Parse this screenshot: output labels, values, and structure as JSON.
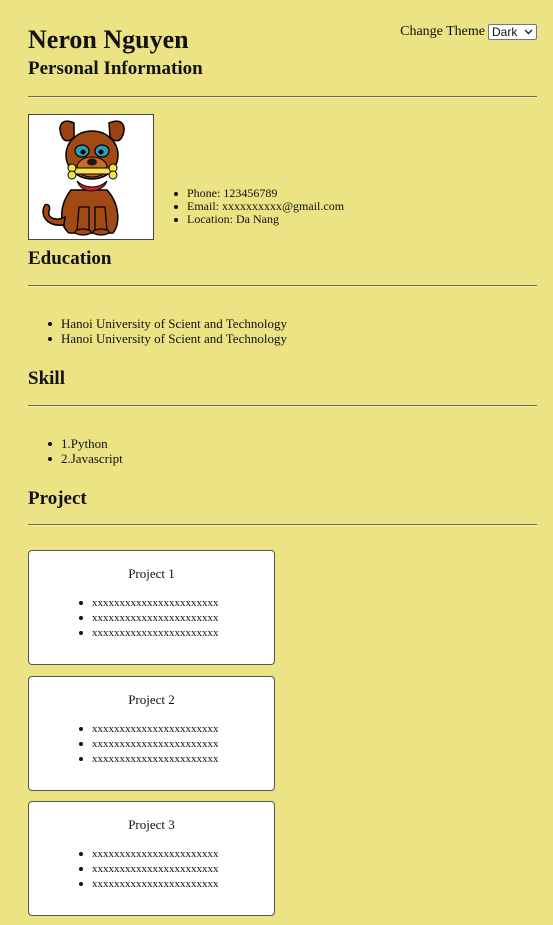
{
  "header": {
    "name": "Neron Nguyen",
    "theme_label": "Change Theme",
    "theme_selected": "Dark"
  },
  "personal": {
    "title": "Personal Information",
    "avatar_icon": "cartoon-dog-avatar",
    "items": [
      "Phone: 123456789",
      "Email: xxxxxxxxxx@gmail.com",
      "Location: Da Nang"
    ]
  },
  "education": {
    "title": "Education",
    "items": [
      "Hanoi University of Scient and Technology",
      "Hanoi University of Scient and Technology"
    ]
  },
  "skill": {
    "title": "Skill",
    "items": [
      "1.Python",
      "2.Javascript"
    ]
  },
  "project": {
    "title": "Project",
    "cards": [
      {
        "title": "Project 1",
        "items": [
          "xxxxxxxxxxxxxxxxxxxxxxx",
          "xxxxxxxxxxxxxxxxxxxxxxx",
          "xxxxxxxxxxxxxxxxxxxxxxx"
        ]
      },
      {
        "title": "Project 2",
        "items": [
          "xxxxxxxxxxxxxxxxxxxxxxx",
          "xxxxxxxxxxxxxxxxxxxxxxx",
          "xxxxxxxxxxxxxxxxxxxxxxx"
        ]
      },
      {
        "title": "Project 3",
        "items": [
          "xxxxxxxxxxxxxxxxxxxxxxx",
          "xxxxxxxxxxxxxxxxxxxxxxx",
          "xxxxxxxxxxxxxxxxxxxxxxx"
        ]
      }
    ]
  },
  "colors": {
    "background": "#ebe384",
    "card_background": "#ffffff",
    "text": "#111111"
  }
}
